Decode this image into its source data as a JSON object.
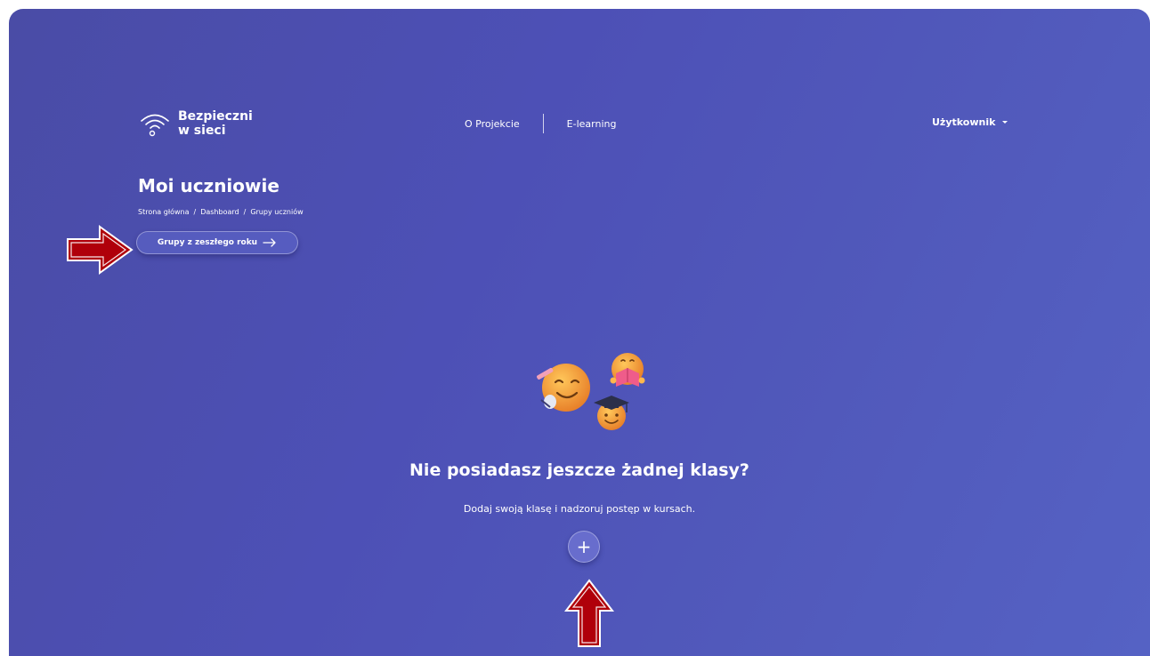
{
  "brand": {
    "name_line1": "Bezpieczni",
    "name_line2": "w sieci",
    "icon": "wifi-icon"
  },
  "nav": {
    "items": [
      {
        "label": "O Projekcie"
      },
      {
        "label": "E-learning"
      }
    ]
  },
  "user_menu": {
    "label": "Użytkownik",
    "icon": "chevron-down-icon"
  },
  "page": {
    "title": "Moi uczniowie",
    "breadcrumb": [
      "Strona główna",
      "Dashboard",
      "Grupy uczniów"
    ],
    "breadcrumb_separator": "/",
    "prev_groups_button": "Grupy z zeszłego roku",
    "prev_groups_icon": "arrow-right-icon"
  },
  "empty_state": {
    "illustration": "emoji-students-illustration",
    "title": "Nie posiadasz jeszcze żadnej klasy?",
    "subtitle": "Dodaj swoją klasę i nadzoruj postęp w kursach.",
    "add_button_symbol": "+",
    "add_button_icon": "plus-icon"
  },
  "annotations": {
    "color": "#b0000a",
    "items": [
      {
        "icon": "red-arrow-right-icon"
      },
      {
        "icon": "red-arrow-up-icon"
      }
    ]
  },
  "colors": {
    "background_start": "#4a4ca6",
    "background_end": "#5562c4",
    "text": "#ffffff"
  }
}
